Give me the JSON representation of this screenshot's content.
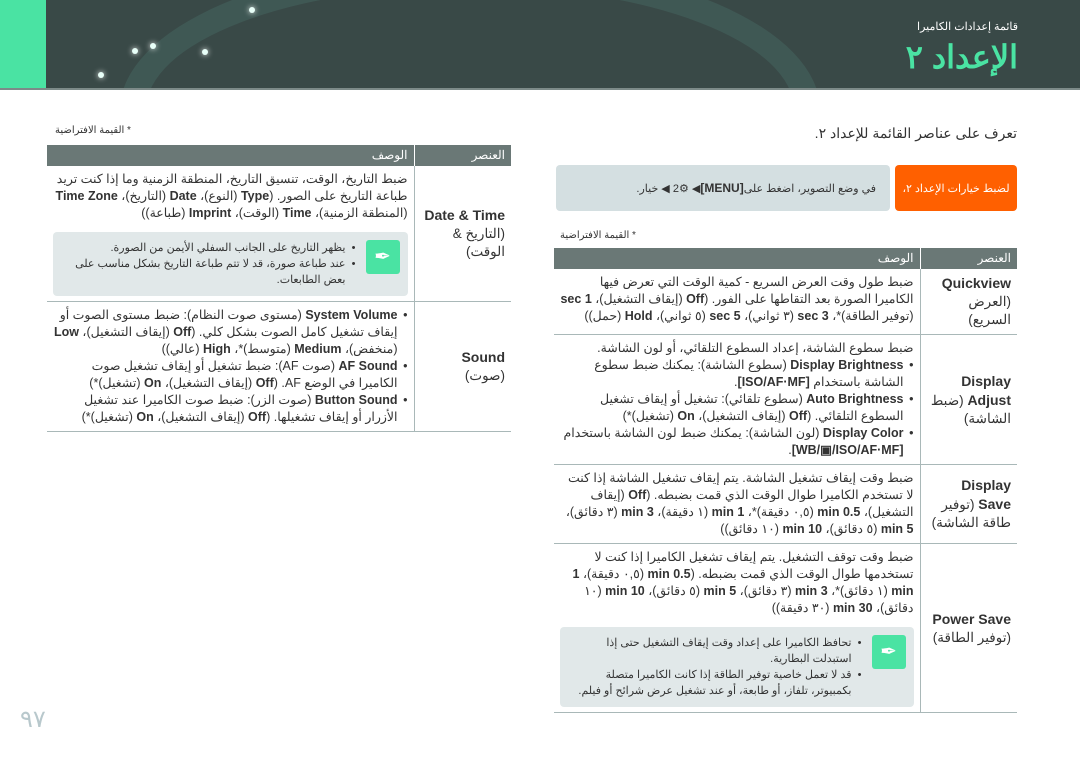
{
  "header": {
    "breadcrumb": "قائمة إعدادات الكاميرا",
    "title": "الإعداد ٢"
  },
  "intro": "تعرف على عناصر القائمة للإعداد ٢.",
  "instruction": {
    "label": "لضبط خيارات الإعداد ٢،",
    "text": [
      "في وضع التصوير، اضغط على ",
      {
        "b": "[MENU]"
      },
      " ◀ ⚙2 ◀ خيار."
    ]
  },
  "default_note": "* القيمة الافتراضية",
  "columns": {
    "item": "العنصر",
    "desc": "الوصف"
  },
  "left_table": {
    "rows": [
      {
        "item": [
          "Date & Time"
        ],
        "item_ar": "(التاريخ & الوقت)",
        "desc": [
          "ضبط التاريخ، الوقت، تنسيق التاريخ، المنطقة الزمنية وما إذا كنت تريد طباعة التاريخ على الصور. (",
          {
            "b": "Type"
          },
          " (النوع)، ",
          {
            "b": "Date"
          },
          " (التاريخ)، ",
          {
            "b": "Time Zone"
          },
          " (المنطقة الزمنية)، ",
          {
            "b": "Time"
          },
          " (الوقت)، ",
          {
            "b": "Imprint"
          },
          " (طباعة))"
        ],
        "notes": [
          "يظهر التاريخ على الجانب السفلي الأيمن من الصورة.",
          "عند طباعة صورة، قد لا تتم طباعة التاريخ بشكل مناسب على بعض الطابعات."
        ]
      },
      {
        "item": [
          "Sound"
        ],
        "item_ar": "(صوت)",
        "bullets": [
          [
            {
              "b": "System Volume"
            },
            " (مستوى صوت النظام): ضبط مستوى الصوت أو إيقاف تشغيل كامل الصوت بشكل كلي. (",
            {
              "b": "Off"
            },
            " (إيقاف التشغيل)، ",
            {
              "b": "Low"
            },
            " (منخفض)، ",
            {
              "b": "Medium"
            },
            " (متوسط)*، ",
            {
              "b": "High"
            },
            " (عالي))"
          ],
          [
            {
              "b": "AF Sound"
            },
            " (صوت AF): ضبط تشغيل أو إيقاف تشغيل صوت الكاميرا في الوضع AF. (",
            {
              "b": "Off"
            },
            " (إيقاف التشغيل)، ",
            {
              "b": "On"
            },
            " (تشغيل)*)"
          ],
          [
            {
              "b": "Button Sound"
            },
            " (صوت الزر): ضبط صوت الكاميرا عند تشغيل الأزرار أو إيقاف تشغيلها. (",
            {
              "b": "Off"
            },
            " (إيقاف التشغيل)، ",
            {
              "b": "On"
            },
            " (تشغيل)*)"
          ]
        ]
      }
    ]
  },
  "right_table": {
    "rows": [
      {
        "item": [
          "Quickview"
        ],
        "item_ar": "(العرض السريع)",
        "desc": [
          "ضبط طول وقت العرض السريع - كمية الوقت التي تعرض فيها الكاميرا الصورة بعد التقاطها على الفور. (",
          {
            "b": "Off"
          },
          " (إيقاف التشغيل)، ",
          {
            "b": "1 sec"
          },
          " (توفير الطاقة)*، ",
          {
            "b": "3 sec"
          },
          " (٣ ثواني)، ",
          {
            "b": "5 sec"
          },
          " (٥ ثواني)، ",
          {
            "b": "Hold"
          },
          " (حمل))"
        ]
      },
      {
        "item": [
          "Display Adjust"
        ],
        "item_ar": "(ضبط الشاشة)",
        "desc": [
          "ضبط سطوع الشاشة، إعداد السطوع التلقائي، أو لون الشاشة."
        ],
        "bullets": [
          [
            {
              "b": "Display Brightness"
            },
            " (سطوع الشاشة): يمكنك ضبط سطوع الشاشة باستخدام ",
            {
              "b": "[ISO/AF·MF]"
            },
            "."
          ],
          [
            {
              "b": "Auto Brightness"
            },
            " (سطوع تلقائي): تشغيل أو إيقاف تشغيل السطوع التلقائي. (",
            {
              "b": "Off"
            },
            " (إيقاف التشغيل)، ",
            {
              "b": "On"
            },
            " (تشغيل)*)"
          ],
          [
            {
              "b": "Display Color"
            },
            " (لون الشاشة): يمكنك ضبط لون الشاشة باستخدام ",
            {
              "b": "[WB/▣/ISO/AF·MF]"
            },
            "."
          ]
        ]
      },
      {
        "item": [
          "Display Save"
        ],
        "item_ar": "(توفير طاقة الشاشة)",
        "desc": [
          "ضبط وقت إيقاف تشغيل الشاشة. يتم إيقاف تشغيل الشاشة إذا كنت لا تستخدم الكاميرا طوال الوقت الذي قمت بضبطه. (",
          {
            "b": "Off"
          },
          " (إيقاف التشغيل)، ",
          {
            "b": "0.5 min"
          },
          " (٠,٥ دقيقة)*، ",
          {
            "b": "1 min"
          },
          " (١ دقيقة)، ",
          {
            "b": "3 min"
          },
          " (٣ دقائق)، ",
          {
            "b": "5 min"
          },
          " (٥ دقائق)، ",
          {
            "b": "10 min"
          },
          " (١٠ دقائق))"
        ]
      },
      {
        "item": [
          "Power Save"
        ],
        "item_ar": "(توفير الطاقة)",
        "desc": [
          "ضبط وقت توقف التشغيل. يتم إيقاف تشغيل الكاميرا إذا كنت لا تستخدمها طوال الوقت الذي قمت بضبطه. (",
          {
            "b": "0.5 min"
          },
          " (٠,٥ دقيقة)، ",
          {
            "b": "1 min"
          },
          " (١ دقائق)*، ",
          {
            "b": "3 min"
          },
          " (٣ دقائق)، ",
          {
            "b": "5 min"
          },
          " (٥ دقائق)، ",
          {
            "b": "10 min"
          },
          " (١٠ دقائق)، ",
          {
            "b": "30 min"
          },
          " (٣٠ دقيقة))"
        ],
        "notes": [
          "تحافظ الكاميرا على إعداد وقت إيقاف التشغيل حتى إذا استبدلت البطارية.",
          "قد لا تعمل خاصية توفير الطاقة إذا كانت الكاميرا متصلة بكمبيوتر، تلفاز، أو طابعة، أو عند تشغيل عرض شرائح أو فيلم."
        ]
      }
    ]
  },
  "page_number": "٩٧",
  "colors": {
    "accent": "#4ae3a3",
    "orange": "#ff6000",
    "header": "#394947"
  }
}
